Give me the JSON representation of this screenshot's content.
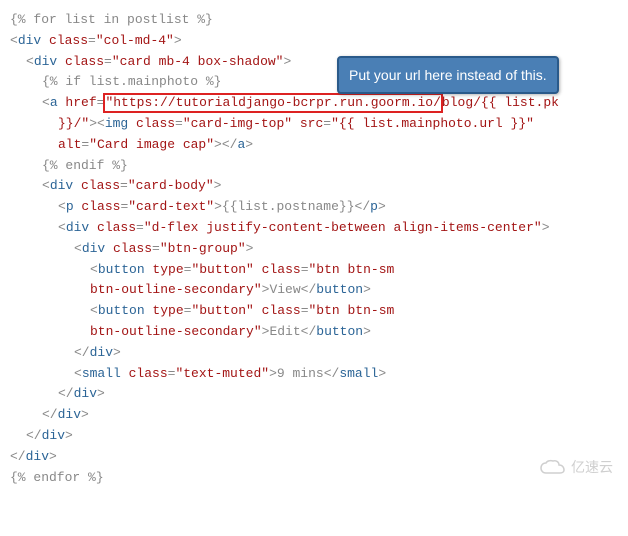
{
  "callout": {
    "text": "Put your url here instead of this."
  },
  "code": {
    "line1": {
      "t1": "{% for list in postlist %}"
    },
    "line2": {
      "p1": "<",
      "tag1": "div",
      "attr1": " class",
      "p2": "=",
      "str1": "\"col-md-4\"",
      "p3": ">"
    },
    "line3": {
      "p1": "<",
      "tag1": "div",
      "attr1": " class",
      "p2": "=",
      "str1": "\"card mb-4 box-shadow\"",
      "p3": ">"
    },
    "line4": {
      "t1": "{% if list.mainphoto %}"
    },
    "line5": {
      "p1": "<",
      "tag1": "a",
      "attr1": " href",
      "p2": "=",
      "str1": "\"https://tutorialdjango-bcrpr.run.goorm.io/",
      "str2": "blog/{{ list.pk"
    },
    "line5b": {
      "str1": "}}/\"",
      "p1": "><",
      "tag1": "img",
      "attr1": " class",
      "p2": "=",
      "str2": "\"card-img-top\"",
      "attr2": " src",
      "p3": "=",
      "str3": "\"{{ list.mainphoto.url }}\""
    },
    "line5c": {
      "attr1": "alt",
      "p1": "=",
      "str1": "\"Card image cap\"",
      "p2": "></",
      "tag1": "a",
      "p3": ">"
    },
    "line6": {
      "t1": "{% endif %}"
    },
    "line7": {
      "p1": "<",
      "tag1": "div",
      "attr1": " class",
      "p2": "=",
      "str1": "\"card-body\"",
      "p3": ">"
    },
    "line8": {
      "p1": "<",
      "tag1": "p",
      "attr1": " class",
      "p2": "=",
      "str1": "\"card-text\"",
      "p3": ">",
      "t1": "{{list.postname}}",
      "p4": "</",
      "tag2": "p",
      "p5": ">"
    },
    "line9": {
      "p1": "<",
      "tag1": "div",
      "attr1": " class",
      "p2": "=",
      "str1": "\"d-flex justify-content-between align-items-center\"",
      "p3": ">"
    },
    "line10": {
      "p1": "<",
      "tag1": "div",
      "attr1": " class",
      "p2": "=",
      "str1": "\"btn-group\"",
      "p3": ">"
    },
    "line11": {
      "p1": "<",
      "tag1": "button",
      "attr1": " type",
      "p2": "=",
      "str1": "\"button\"",
      "attr2": " class",
      "p3": "=",
      "str2": "\"btn btn-sm"
    },
    "line11b": {
      "str1": "btn-outline-secondary\"",
      "p1": ">",
      "t1": "View",
      "p2": "</",
      "tag1": "button",
      "p3": ">"
    },
    "line12": {
      "p1": "<",
      "tag1": "button",
      "attr1": " type",
      "p2": "=",
      "str1": "\"button\"",
      "attr2": " class",
      "p3": "=",
      "str2": "\"btn btn-sm"
    },
    "line12b": {
      "str1": "btn-outline-secondary\"",
      "p1": ">",
      "t1": "Edit",
      "p2": "</",
      "tag1": "button",
      "p3": ">"
    },
    "line13": {
      "p1": "</",
      "tag1": "div",
      "p2": ">"
    },
    "line14": {
      "p1": "<",
      "tag1": "small",
      "attr1": " class",
      "p2": "=",
      "str1": "\"text-muted\"",
      "p3": ">",
      "t1": "9 mins",
      "p4": "</",
      "tag2": "small",
      "p5": ">"
    },
    "line15": {
      "p1": "</",
      "tag1": "div",
      "p2": ">"
    },
    "line16": {
      "p1": "</",
      "tag1": "div",
      "p2": ">"
    },
    "line17": {
      "p1": "</",
      "tag1": "div",
      "p2": ">"
    },
    "line18": {
      "p1": "</",
      "tag1": "div",
      "p2": ">"
    },
    "line19": {
      "t1": "{% endfor %}"
    }
  },
  "watermark": {
    "text": "亿速云"
  }
}
